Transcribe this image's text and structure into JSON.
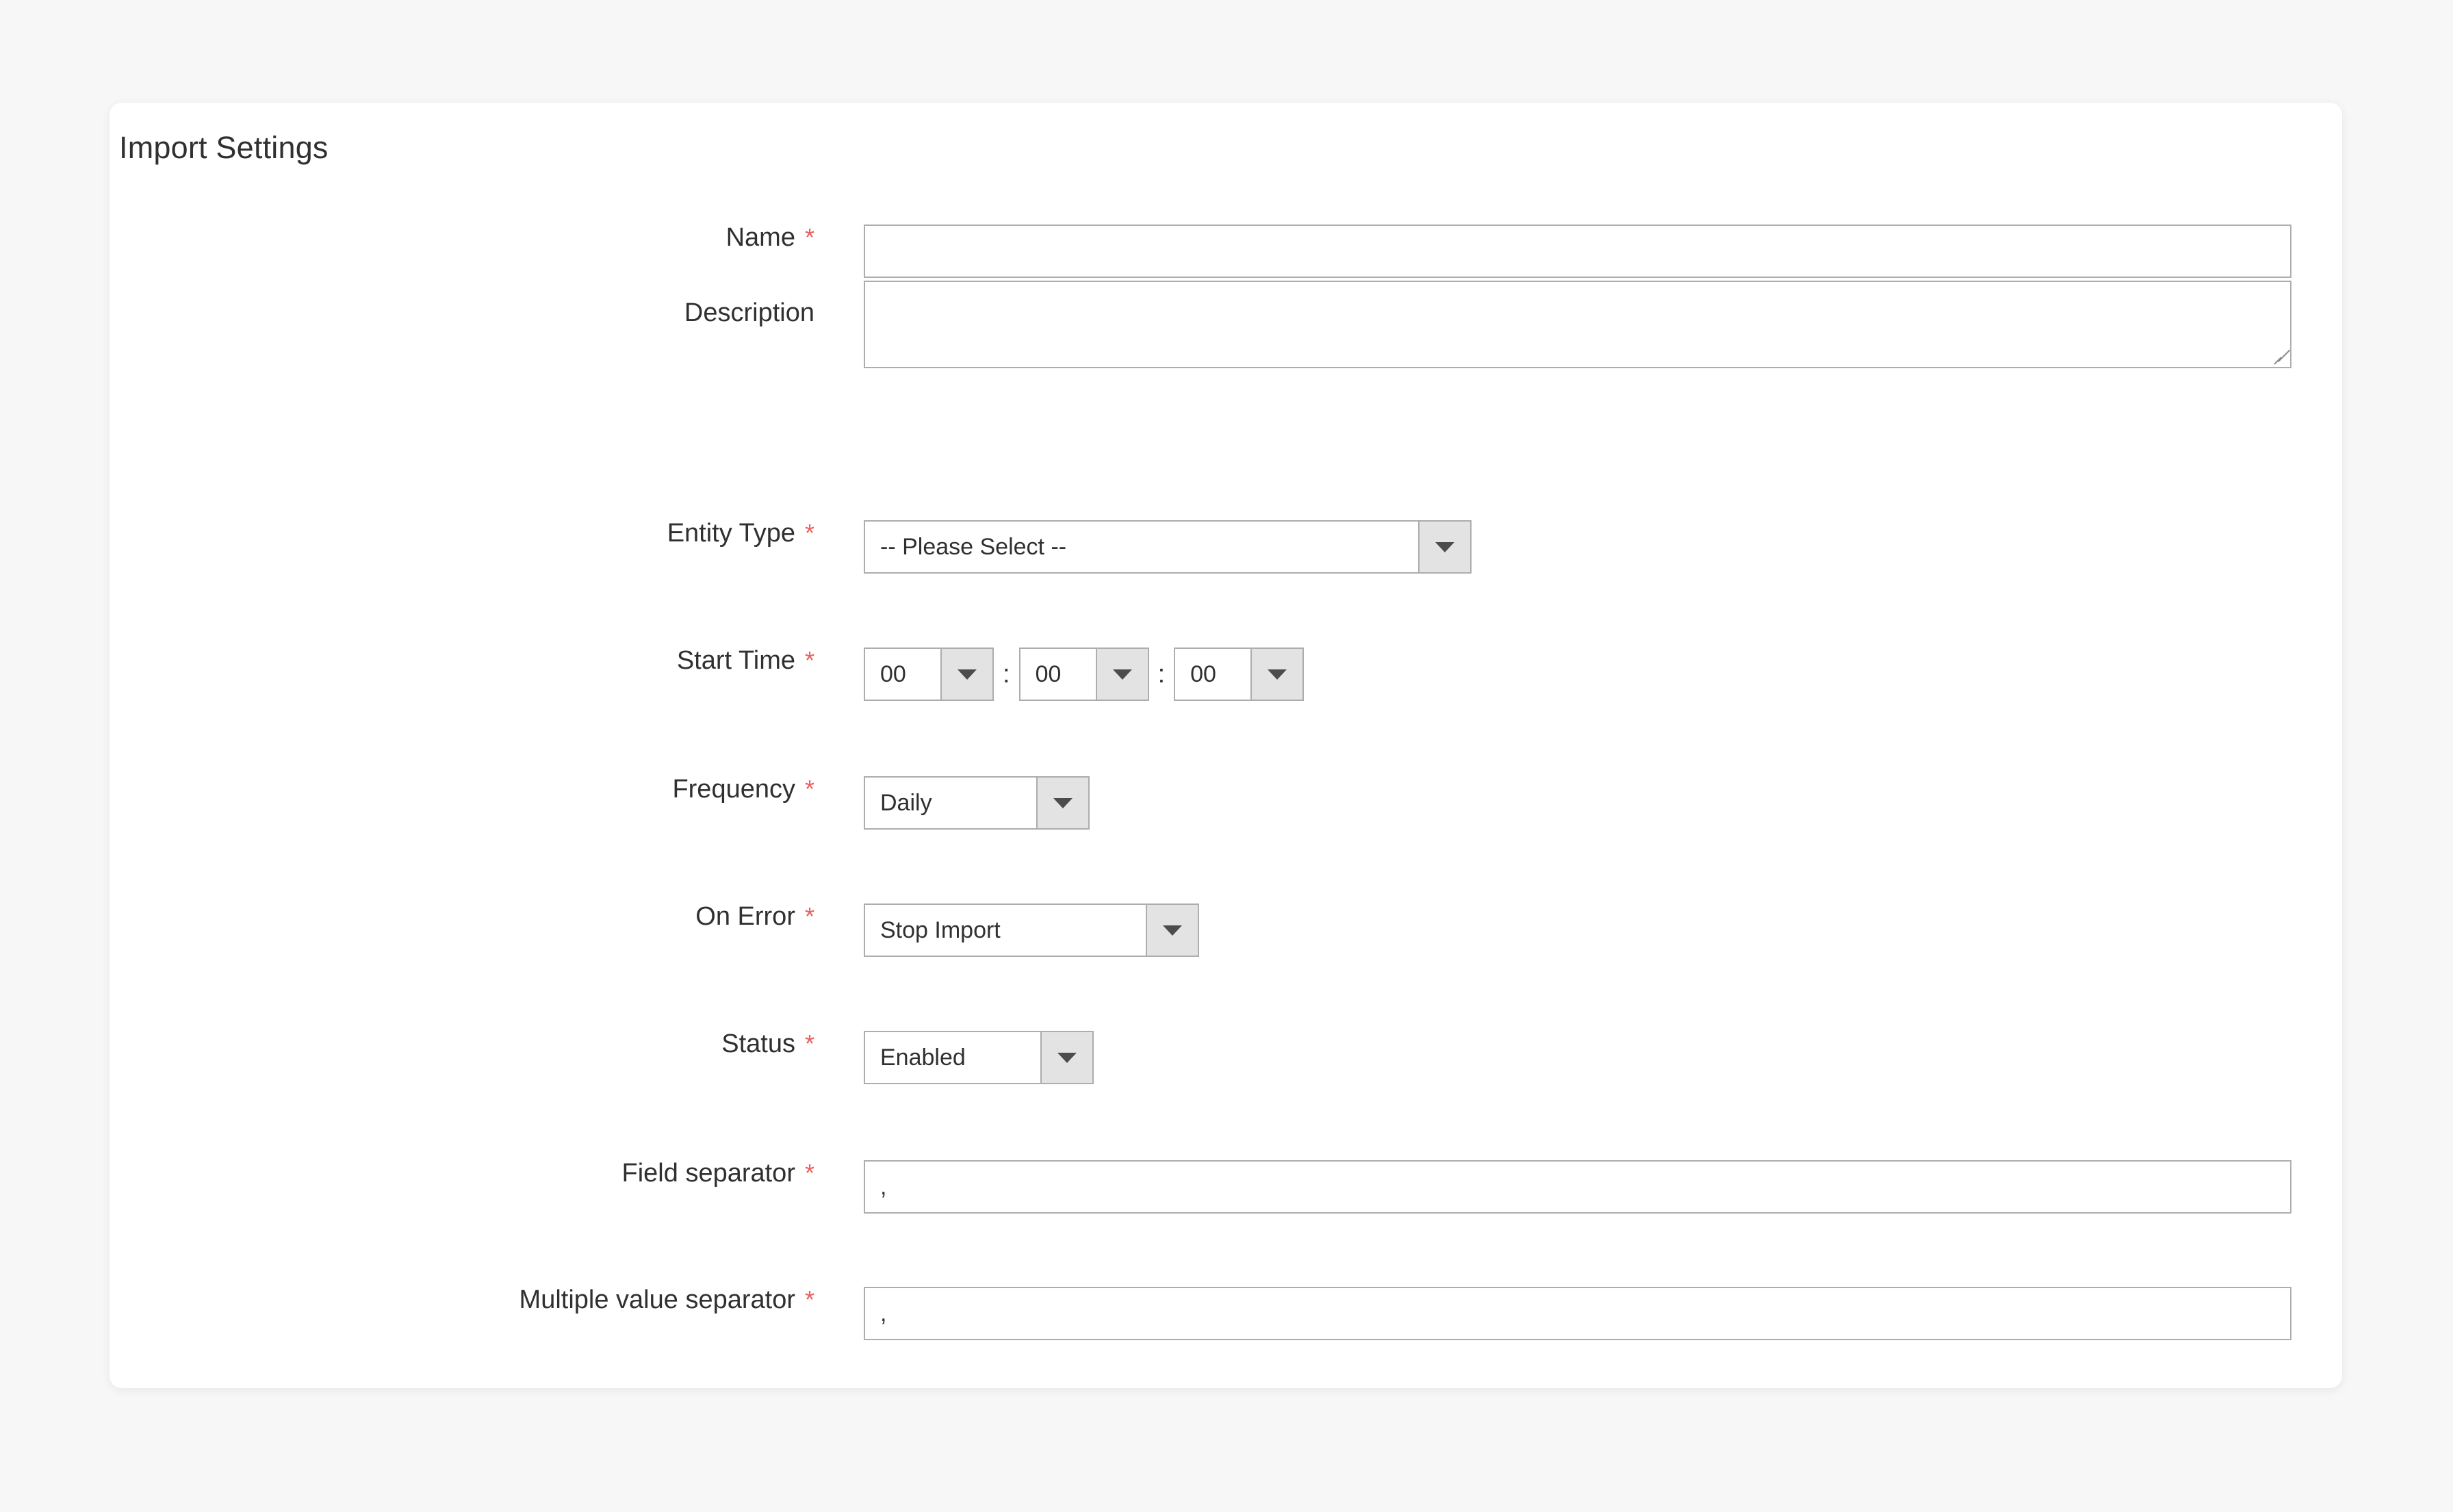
{
  "panel": {
    "title": "Import Settings"
  },
  "form": {
    "fields": [
      {
        "key": "name",
        "label": "Name",
        "required": true,
        "control": "text",
        "value": "",
        "placeholder": ""
      },
      {
        "key": "description",
        "label": "Description",
        "required": false,
        "control": "textarea",
        "value": "",
        "placeholder": ""
      },
      {
        "key": "entity_type",
        "label": "Entity Type",
        "required": true,
        "control": "select",
        "value": "-- Please Select --"
      },
      {
        "key": "start_time",
        "label": "Start Time",
        "required": true,
        "control": "time",
        "hours": "00",
        "minutes": "00",
        "seconds": "00",
        "separator": ":"
      },
      {
        "key": "frequency",
        "label": "Frequency",
        "required": true,
        "control": "select",
        "value": "Daily"
      },
      {
        "key": "on_error",
        "label": "On Error",
        "required": true,
        "control": "select",
        "value": "Stop Import"
      },
      {
        "key": "status",
        "label": "Status",
        "required": true,
        "control": "select",
        "value": "Enabled"
      },
      {
        "key": "field_separator",
        "label": "Field separator",
        "required": true,
        "control": "text",
        "value": ",",
        "placeholder": ""
      },
      {
        "key": "multiple_value_separator",
        "label": "Multiple value separator",
        "required": true,
        "control": "text",
        "value": ",",
        "placeholder": ""
      }
    ],
    "required_marker": "*"
  },
  "icons": {
    "dropdown_caret": "chevron-down-icon",
    "textarea_resize": "resize-grip-icon"
  },
  "colors": {
    "page_background": "#f7f7f7",
    "panel_background": "#ffffff",
    "label_text": "#303030",
    "required_asterisk": "#e85f5c",
    "input_border": "#adadad",
    "select_button_background": "#e3e3e3",
    "caret": "#4c4c4c"
  }
}
